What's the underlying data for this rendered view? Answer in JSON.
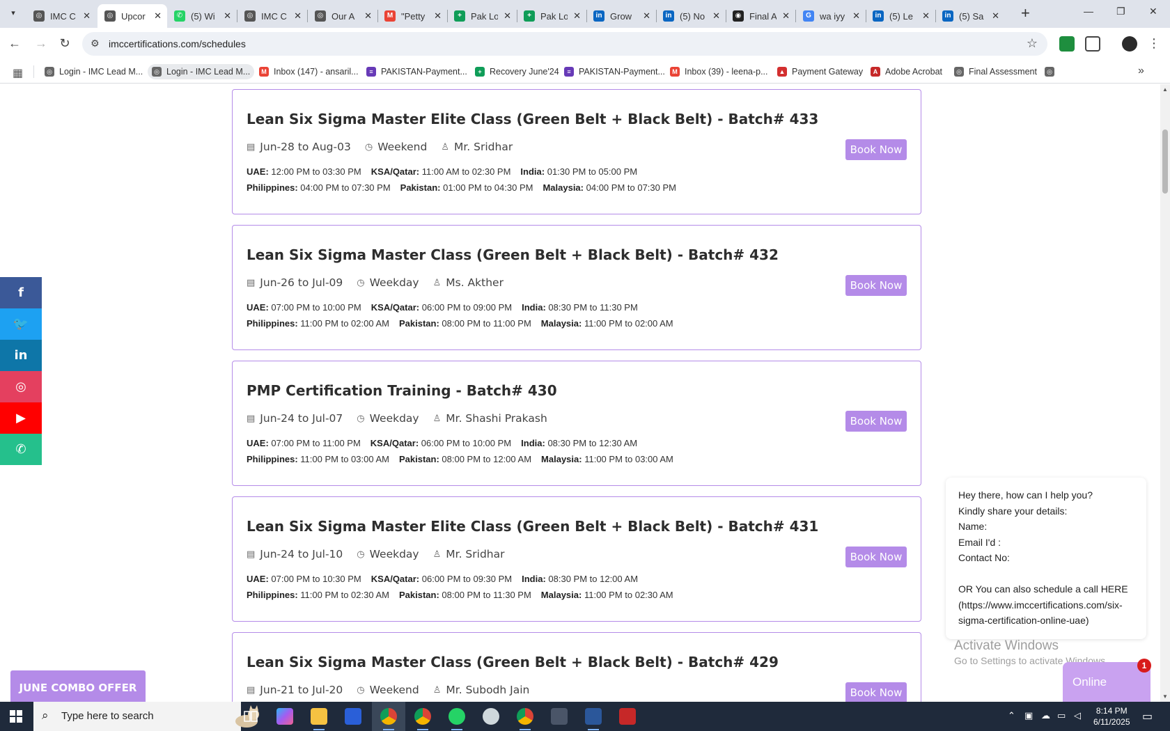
{
  "browser": {
    "tabs": [
      {
        "label": "IMC C",
        "fav_color": "#555555",
        "fav_glyph": "◎"
      },
      {
        "label": "Upcor",
        "fav_color": "#555555",
        "fav_glyph": "◎"
      },
      {
        "label": "(5) Wi",
        "fav_color": "#25d366",
        "fav_glyph": "✆"
      },
      {
        "label": "IMC C",
        "fav_color": "#555555",
        "fav_glyph": "◎"
      },
      {
        "label": "Our A",
        "fav_color": "#555555",
        "fav_glyph": "◎"
      },
      {
        "label": "\"Petty",
        "fav_color": "#ea4335",
        "fav_glyph": "M"
      },
      {
        "label": "Pak Lo",
        "fav_color": "#0f9d58",
        "fav_glyph": "+"
      },
      {
        "label": "Pak Lo",
        "fav_color": "#0f9d58",
        "fav_glyph": "+"
      },
      {
        "label": "Grow",
        "fav_color": "#0a66c2",
        "fav_glyph": "in"
      },
      {
        "label": "(5) No",
        "fav_color": "#0a66c2",
        "fav_glyph": "in"
      },
      {
        "label": "Final A",
        "fav_color": "#222222",
        "fav_glyph": "◉"
      },
      {
        "label": "wa iyy",
        "fav_color": "#4285f4",
        "fav_glyph": "G"
      },
      {
        "label": "(5) Le",
        "fav_color": "#0a66c2",
        "fav_glyph": "in"
      },
      {
        "label": "(5) Sa",
        "fav_color": "#0a66c2",
        "fav_glyph": "in"
      }
    ],
    "active_tab_index": 1,
    "url": "imccertifications.com/schedules",
    "bookmarks": [
      {
        "label": "Login - IMC Lead M...",
        "fav_color": "#666666",
        "fav_glyph": "◎"
      },
      {
        "label": "Login - IMC Lead M...",
        "fav_color": "#666666",
        "fav_glyph": "◎"
      },
      {
        "label": "Inbox (147) - ansaril...",
        "fav_color": "#ea4335",
        "fav_glyph": "M"
      },
      {
        "label": "PAKISTAN-Payment...",
        "fav_color": "#673ab7",
        "fav_glyph": "≡"
      },
      {
        "label": "Recovery June'24",
        "fav_color": "#0f9d58",
        "fav_glyph": "+"
      },
      {
        "label": "PAKISTAN-Payment...",
        "fav_color": "#673ab7",
        "fav_glyph": "≡"
      },
      {
        "label": "Inbox (39) - leena-p...",
        "fav_color": "#ea4335",
        "fav_glyph": "M"
      },
      {
        "label": "Payment Gateway",
        "fav_color": "#d32f2f",
        "fav_glyph": "▲"
      },
      {
        "label": "Adobe Acrobat",
        "fav_color": "#c62828",
        "fav_glyph": "A"
      },
      {
        "label": "Final Assessment",
        "fav_color": "#666666",
        "fav_glyph": "◎"
      }
    ]
  },
  "schedules": [
    {
      "title": "Lean Six Sigma Master Elite Class (Green Belt + Black Belt) - Batch# 433",
      "dates": "Jun-28 to Aug-03",
      "type": "Weekend",
      "trainer": "Mr. Sridhar",
      "row1": [
        {
          "k": "UAE:",
          "v": "12:00 PM to 03:30 PM"
        },
        {
          "k": "KSA/Qatar:",
          "v": "11:00 AM to 02:30 PM"
        },
        {
          "k": "India:",
          "v": "01:30 PM to 05:00 PM"
        }
      ],
      "row2": [
        {
          "k": "Philippines:",
          "v": "04:00 PM to 07:30 PM"
        },
        {
          "k": "Pakistan:",
          "v": "01:00 PM to 04:30 PM"
        },
        {
          "k": "Malaysia:",
          "v": "04:00 PM to 07:30 PM"
        }
      ],
      "button": "Book Now"
    },
    {
      "title": "Lean Six Sigma Master Class (Green Belt + Black Belt) - Batch# 432",
      "dates": "Jun-26 to Jul-09",
      "type": "Weekday",
      "trainer": "Ms. Akther",
      "row1": [
        {
          "k": "UAE:",
          "v": "07:00 PM to 10:00 PM"
        },
        {
          "k": "KSA/Qatar:",
          "v": "06:00 PM to 09:00 PM"
        },
        {
          "k": "India:",
          "v": "08:30 PM to 11:30 PM"
        }
      ],
      "row2": [
        {
          "k": "Philippines:",
          "v": "11:00 PM to 02:00 AM"
        },
        {
          "k": "Pakistan:",
          "v": "08:00 PM to 11:00 PM"
        },
        {
          "k": "Malaysia:",
          "v": "11:00 PM to 02:00 AM"
        }
      ],
      "button": "Book Now"
    },
    {
      "title": "PMP Certification Training - Batch# 430",
      "dates": "Jun-24 to Jul-07",
      "type": "Weekday",
      "trainer": "Mr. Shashi Prakash",
      "row1": [
        {
          "k": "UAE:",
          "v": "07:00 PM to 11:00 PM"
        },
        {
          "k": "KSA/Qatar:",
          "v": "06:00 PM to 10:00 PM"
        },
        {
          "k": "India:",
          "v": "08:30 PM to 12:30 AM"
        }
      ],
      "row2": [
        {
          "k": "Philippines:",
          "v": "11:00 PM to 03:00 AM"
        },
        {
          "k": "Pakistan:",
          "v": "08:00 PM to 12:00 AM"
        },
        {
          "k": "Malaysia:",
          "v": "11:00 PM to 03:00 AM"
        }
      ],
      "button": "Book Now"
    },
    {
      "title": "Lean Six Sigma Master Elite Class (Green Belt + Black Belt) - Batch# 431",
      "dates": "Jun-24 to Jul-10",
      "type": "Weekday",
      "trainer": "Mr. Sridhar",
      "row1": [
        {
          "k": "UAE:",
          "v": "07:00 PM to 10:30 PM"
        },
        {
          "k": "KSA/Qatar:",
          "v": "06:00 PM to 09:30 PM"
        },
        {
          "k": "India:",
          "v": "08:30 PM to 12:00 AM"
        }
      ],
      "row2": [
        {
          "k": "Philippines:",
          "v": "11:00 PM to 02:30 AM"
        },
        {
          "k": "Pakistan:",
          "v": "08:00 PM to 11:30 PM"
        },
        {
          "k": "Malaysia:",
          "v": "11:00 PM to 02:30 AM"
        }
      ],
      "button": "Book Now"
    },
    {
      "title": "Lean Six Sigma Master Class (Green Belt + Black Belt) - Batch# 429",
      "dates": "Jun-21 to Jul-20",
      "type": "Weekend",
      "trainer": "Mr. Subodh Jain",
      "row1": [],
      "row2": [],
      "button": "Book Now"
    }
  ],
  "social": [
    {
      "name": "facebook",
      "glyph": "f",
      "color": "#3b5998"
    },
    {
      "name": "twitter",
      "glyph": "🐦",
      "color": "#1da1f2"
    },
    {
      "name": "linkedin",
      "glyph": "in",
      "color": "#0e76a8"
    },
    {
      "name": "instagram",
      "glyph": "◎",
      "color": "#e4405f"
    },
    {
      "name": "youtube",
      "glyph": "▶",
      "color": "#ff0000"
    },
    {
      "name": "whatsapp",
      "glyph": "✆",
      "color": "#25c08c"
    }
  ],
  "combo_offer": "JUNE COMBO OFFER",
  "chat": {
    "lines": [
      "Hey there, how can I help you?",
      "Kindly share your details:",
      "Name:",
      "Email I'd :",
      "Contact No:",
      "",
      "OR You can also schedule a call HERE",
      "(https://www.imccertifications.com/six-",
      "sigma-certification-online-uae)"
    ],
    "online_label": "Online",
    "badge": "1"
  },
  "watermark": {
    "line1": "Activate Windows",
    "line2": "Go to Settings to activate Windows."
  },
  "taskbar": {
    "search_placeholder": "Type here to search",
    "time": "8:14 PM",
    "date": "6/11/2025"
  },
  "colors": {
    "accent": "#b48be8",
    "online": "#c9a2f0",
    "taskbar": "#1f2a3b"
  }
}
